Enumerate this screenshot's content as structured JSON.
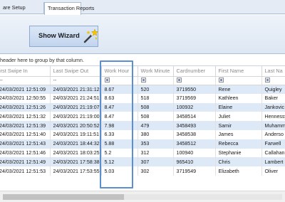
{
  "tabs": [
    {
      "label": "are Setup"
    },
    {
      "label": "Transaction Reports"
    }
  ],
  "ribbon": {
    "show_wizard_label": "Show Wizard",
    "wand_icon": "magic-wand-icon"
  },
  "grid": {
    "group_hint": "header here to group by that column.",
    "columns": [
      "irst Swipe In",
      "Last Swipe Out",
      "Work Hour",
      "Work Minute",
      "Cardnumber",
      "First Name",
      "Last Na"
    ],
    "filter": [
      "--",
      "--",
      "",
      "",
      "",
      "",
      ""
    ],
    "rows": [
      [
        "24/03/2021 12:51:09",
        "24/03/2021 21:31:12",
        "8.67",
        "520",
        "3719550",
        "Rene",
        "Quigley"
      ],
      [
        "24/03/2021 12:50:55",
        "24/03/2021 21:24:51",
        "8.63",
        "518",
        "3719569",
        "Kathleen",
        "Baker"
      ],
      [
        "24/03/2021 12:51:26",
        "24/03/2021 21:19:07",
        "8.47",
        "508",
        "100932",
        "Elaine",
        "Jankovic"
      ],
      [
        "24/03/2021 12:51:32",
        "24/03/2021 21:19:00",
        "8.47",
        "508",
        "3458514",
        "Juliet",
        "Hennessy"
      ],
      [
        "24/03/2021 12:51:39",
        "24/03/2021 20:50:52",
        "7.98",
        "479",
        "3458493",
        "Samir",
        "Muhamm"
      ],
      [
        "24/03/2021 12:51:40",
        "24/03/2021 19:11:51",
        "6.33",
        "380",
        "3458538",
        "James",
        "Anderso"
      ],
      [
        "24/03/2021 12:51:43",
        "24/03/2021 18:44:32",
        "5.88",
        "353",
        "3458512",
        "Rebecca",
        "Farwell"
      ],
      [
        "24/03/2021 12:51:46",
        "24/03/2021 18:03:25",
        "5.2",
        "312",
        "100940",
        "Stephanie",
        "Callahan"
      ],
      [
        "24/03/2021 12:51:49",
        "24/03/2021 17:58:38",
        "5.12",
        "307",
        "965410",
        "Chris",
        "Lambert"
      ],
      [
        "24/03/2021 12:51:53",
        "24/03/2021 17:53:55",
        "5.03",
        "302",
        "3719549",
        "Elizabeth",
        "Oliver"
      ]
    ]
  },
  "colors": {
    "accent": "#5b8fd0",
    "row_alt": "#dde9f7"
  }
}
